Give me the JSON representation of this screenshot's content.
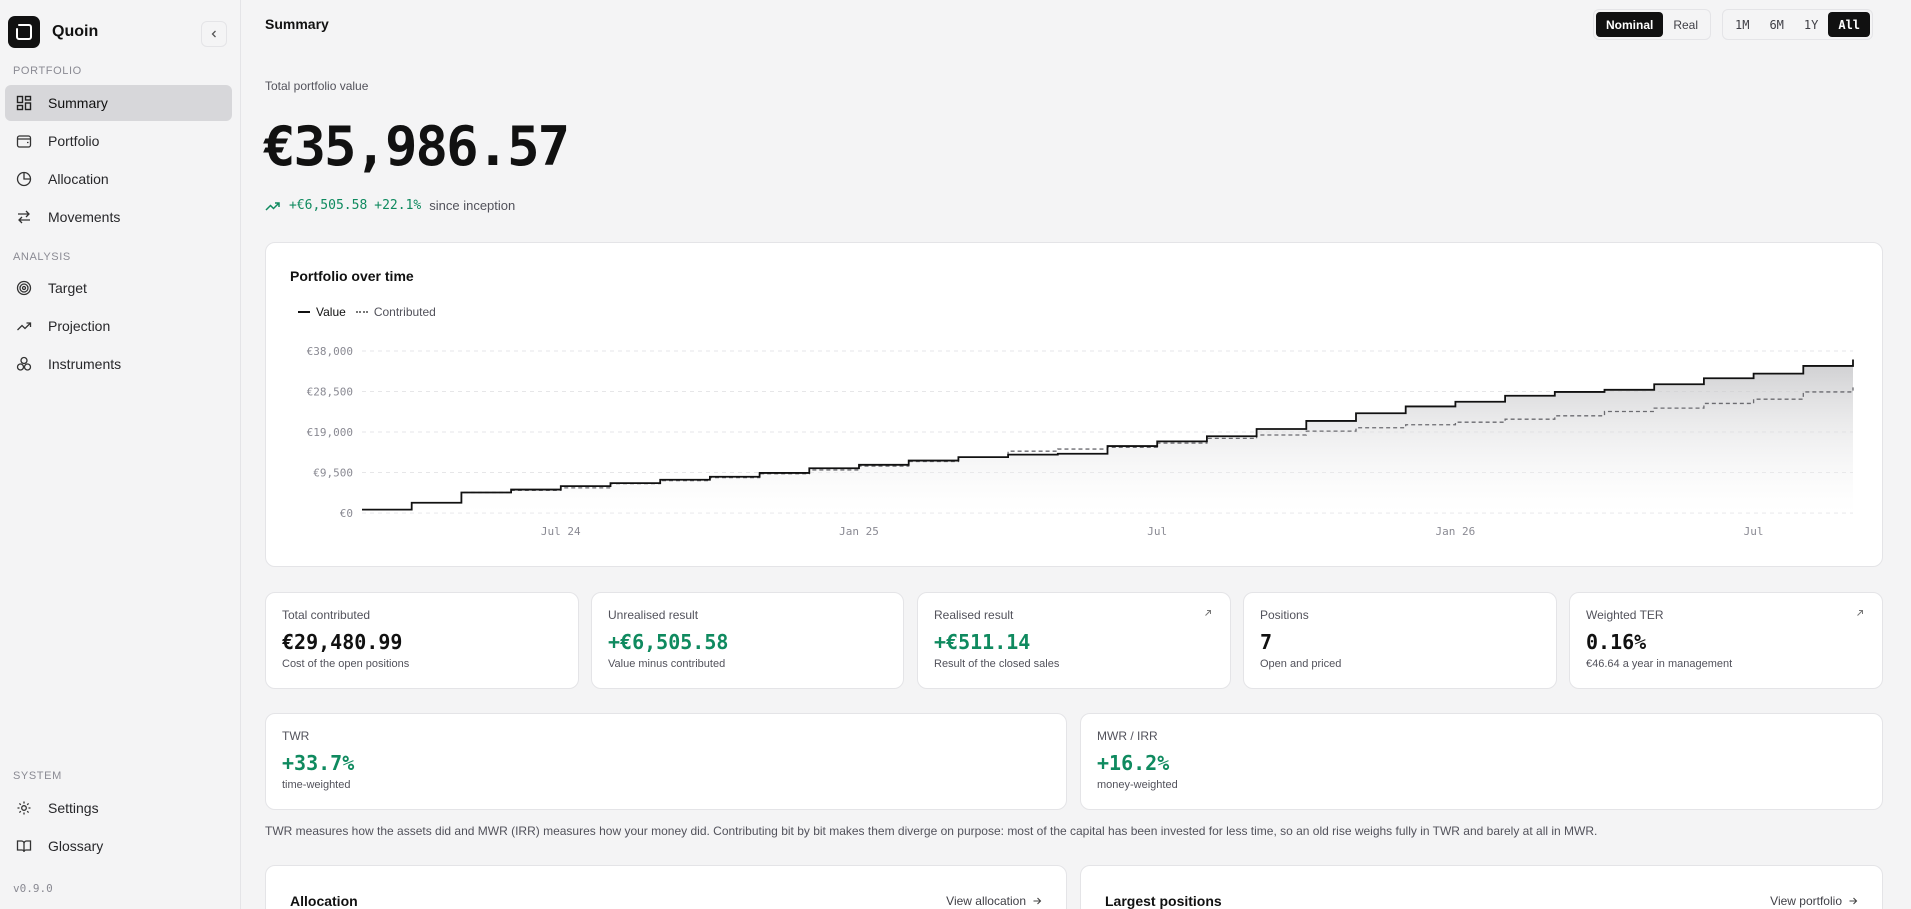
{
  "app": {
    "name": "Quoin",
    "version": "v0.9.0"
  },
  "sidebar": {
    "portfolio_label": "PORTFOLIO",
    "analysis_label": "ANALYSIS",
    "system_label": "SYSTEM",
    "items": [
      {
        "label": "Summary",
        "icon": "grid-icon"
      },
      {
        "label": "Portfolio",
        "icon": "wallet-icon"
      },
      {
        "label": "Allocation",
        "icon": "pie-icon"
      },
      {
        "label": "Movements",
        "icon": "arrows-icon"
      },
      {
        "label": "Target",
        "icon": "target-icon"
      },
      {
        "label": "Projection",
        "icon": "trend-icon"
      },
      {
        "label": "Instruments",
        "icon": "circles-icon"
      },
      {
        "label": "Settings",
        "icon": "gear-icon"
      },
      {
        "label": "Glossary",
        "icon": "book-icon"
      }
    ]
  },
  "header": {
    "title": "Summary",
    "mode_options": [
      "Nominal",
      "Real"
    ],
    "mode_selected": "Nominal",
    "range_options": [
      "1M",
      "6M",
      "1Y",
      "All"
    ],
    "range_selected": "All"
  },
  "summary": {
    "total_label": "Total portfolio value",
    "total_value": "€35,986.57",
    "change_amount": "+€6,505.58",
    "change_pct": "+22.1%",
    "change_suffix": "since inception"
  },
  "chart_card": {
    "title": "Portfolio over time",
    "legend_value": "Value",
    "legend_contributed": "Contributed"
  },
  "chart_data": {
    "type": "line",
    "x_tick_labels": [
      "Jul 24",
      "Jan 25",
      "Jul",
      "Jan 26",
      "Jul"
    ],
    "y_tick_labels": [
      "€38,000",
      "€28,500",
      "€19,000",
      "€9,500",
      "€0"
    ],
    "ylim": [
      0,
      38000
    ],
    "grid": true,
    "legend": "top-left",
    "series": [
      {
        "name": "Value",
        "style": "solid",
        "x": [
          "2024-03",
          "2024-04",
          "2024-05",
          "2024-06",
          "2024-07",
          "2024-08",
          "2024-09",
          "2024-10",
          "2024-11",
          "2024-12",
          "2025-01",
          "2025-02",
          "2025-03",
          "2025-04",
          "2025-05",
          "2025-06",
          "2025-07",
          "2025-08",
          "2025-09",
          "2025-10",
          "2025-11",
          "2025-12",
          "2026-01",
          "2026-02",
          "2026-03",
          "2026-04",
          "2026-05",
          "2026-06",
          "2026-07",
          "2026-08",
          "2026-09"
        ],
        "values": [
          800,
          2400,
          4800,
          5500,
          6300,
          7000,
          7800,
          8500,
          9400,
          10500,
          11300,
          12300,
          13100,
          13700,
          13900,
          15700,
          16800,
          18000,
          19700,
          21600,
          23400,
          25000,
          26100,
          27500,
          28400,
          28900,
          30200,
          31600,
          32700,
          34500,
          36000
        ]
      },
      {
        "name": "Contributed",
        "style": "dotted",
        "x": [
          "2024-03",
          "2024-04",
          "2024-05",
          "2024-06",
          "2024-07",
          "2024-08",
          "2024-09",
          "2024-10",
          "2024-11",
          "2024-12",
          "2025-01",
          "2025-02",
          "2025-03",
          "2025-04",
          "2025-05",
          "2025-06",
          "2025-07",
          "2025-08",
          "2025-09",
          "2025-10",
          "2025-11",
          "2025-12",
          "2026-01",
          "2026-02",
          "2026-03",
          "2026-04",
          "2026-05",
          "2026-06",
          "2026-07",
          "2026-08",
          "2026-09"
        ],
        "values": [
          800,
          2400,
          4800,
          5300,
          5900,
          6900,
          7600,
          8300,
          9200,
          10100,
          11000,
          12100,
          13100,
          14500,
          15000,
          15400,
          16400,
          17500,
          18300,
          19200,
          20000,
          20700,
          21300,
          22000,
          22800,
          23800,
          24600,
          25700,
          26700,
          28400,
          29480
        ]
      }
    ]
  },
  "stats": [
    {
      "label": "Total contributed",
      "value": "€29,480.99",
      "sub": "Cost of the open positions",
      "positive": false,
      "link": false
    },
    {
      "label": "Unrealised result",
      "value": "+€6,505.58",
      "sub": "Value minus contributed",
      "positive": true,
      "link": false
    },
    {
      "label": "Realised result",
      "value": "+€511.14",
      "sub": "Result of the closed sales",
      "positive": true,
      "link": true
    },
    {
      "label": "Positions",
      "value": "7",
      "sub": "Open and priced",
      "positive": false,
      "link": false
    },
    {
      "label": "Weighted TER",
      "value": "0.16%",
      "sub": "€46.64 a year in management",
      "positive": false,
      "link": true
    }
  ],
  "returns": [
    {
      "label": "TWR",
      "value": "+33.7%",
      "sub": "time-weighted"
    },
    {
      "label": "MWR / IRR",
      "value": "+16.2%",
      "sub": "money-weighted"
    }
  ],
  "explain_text": "TWR measures how the assets did and MWR (IRR) measures how your money did. Contributing bit by bit makes them diverge on purpose: most of the capital has been invested for less time, so an old rise weighs fully in TWR and barely at all in MWR.",
  "bottom_cards": [
    {
      "title": "Allocation",
      "link": "View allocation"
    },
    {
      "title": "Largest positions",
      "link": "View portfolio"
    }
  ],
  "colors": {
    "positive": "#0f8a5f",
    "accent": "#111111",
    "background": "#f4f4f5"
  }
}
